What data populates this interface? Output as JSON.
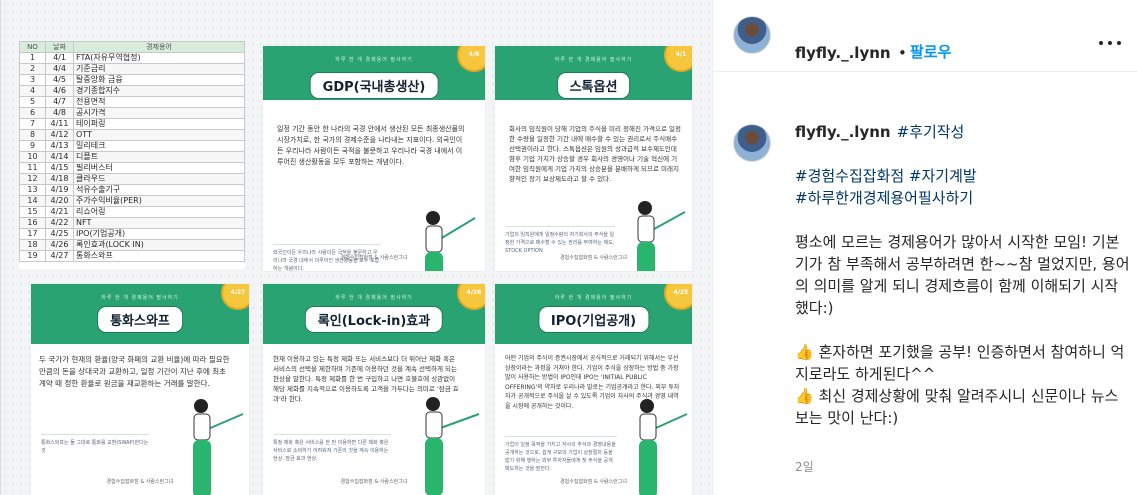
{
  "sheet": {
    "headers": [
      "NO",
      "날짜",
      "경제용어"
    ],
    "rows": [
      [
        "1",
        "4/1",
        "FTA(자유무역협정)"
      ],
      [
        "2",
        "4/4",
        "기준금리"
      ],
      [
        "3",
        "4/5",
        "탈중앙화 금융"
      ],
      [
        "4",
        "4/6",
        "경기종합지수"
      ],
      [
        "5",
        "4/7",
        "전용면적"
      ],
      [
        "6",
        "4/8",
        "공시가격"
      ],
      [
        "7",
        "4/11",
        "테이퍼링"
      ],
      [
        "8",
        "4/12",
        "OTT"
      ],
      [
        "9",
        "4/13",
        "밀리테크"
      ],
      [
        "10",
        "4/14",
        "디플트"
      ],
      [
        "11",
        "4/15",
        "필리버스터"
      ],
      [
        "12",
        "4/18",
        "클라우드"
      ],
      [
        "13",
        "4/19",
        "석유수출기구"
      ],
      [
        "14",
        "4/20",
        "주가수익비율(PER)"
      ],
      [
        "15",
        "4/21",
        "리쇼어링"
      ],
      [
        "16",
        "4/22",
        "NFT"
      ],
      [
        "17",
        "4/25",
        "IPO(기업공개)"
      ],
      [
        "18",
        "4/26",
        "록인효과(LOCK IN)"
      ],
      [
        "19",
        "4/27",
        "통화스와프"
      ]
    ]
  },
  "cards": [
    {
      "kicker": "하루 한 개 경제용어 필사하기",
      "title": "GDP(국내총생산)",
      "body": "일정 기간 동안 한 나라의 국경 안에서 생산된 모든 최종생산물의 시장가치로, 한 국가의 경제수준을 나타내는 지표이다. 외국인이든 우리나라 사람이든 국적을 불문하고 우리나라 국경 내에서 이루어진 생산활동을 모두 포함하는 개념이다.",
      "note": "외국인이든 우리나라 사람이든 국적을 불문하고 우리나라 국경 내에서 이루어진 생산활동을 모두 포함하는 개념이다.",
      "foot": "경험수집잡화점 & 사람스런그녀",
      "badge": "4/6"
    },
    {
      "kicker": "하루 한 개 경제용어 필사하기",
      "title": "스톡옵션",
      "body": "회사의 임직원이 당해 기업의 주식을 미리 정해진 가격으로 일정한 수량을 일정한 기간 내에 매수할 수 있는 권리로서 주식매수선택권이라고 한다. 스톡옵션은 임원의 성과급적 보수제도인데 향후 기업 가치가 상승할 경우 회사의 경영이나 기술 혁신에 기여한 임직원에게 기업 가치의 상승분을 분배하게 되므로 미래지향적인 장기 보상제도라고 할 수 있다.",
      "note": "기업의 임직원에게 일정수량의 자기회사의 주식을 일정한 가격으로 매수할 수 있는 권리를 부여하는 제도, STOCK OPTION",
      "foot": "경험수집잡화점 & 사람스런그녀",
      "badge": "4/1"
    },
    {
      "kicker": "하루 한 개 경제용어 필사하기",
      "title": "통화스와프",
      "body": "두 국가가 현재의 환율(양국 화폐의 교환 비율)에 따라 필요한 만큼의 돈을 상대국과 교환하고, 일정 기간이 지난 후에 최초 계약 때 정한 환율로 원금을 재교환하는 거래를 말한다.",
      "note": "통화스와프는 둘 그대로 통화를 교환(SWAP)한다는 것",
      "foot": "경험수집잡화점 & 사람스런그녀",
      "badge": "4/27"
    },
    {
      "kicker": "하루 한 개 경제용어 필사하기",
      "title": "록인(Lock-in)효과",
      "body": "현재 이용하고 있는 특정 제화 또는 서비스보다 더 뛰어난 제화 혹은 서비스의 선택을 제한하며 기존에 이용하던 것을 계속 선택하게 되는 현상을 말한다. 특정 제화를 한 번 구입하고 나면 호불호에 상관없이 해당 제화를 지속적으로 이용하도록 고객을 가두다는 의미로 '잠금 효과'라 한다.",
      "note": "특정 제화 혹은 서비스를 한 번 이용하면 다른 제화 혹은 서비스로 소비하기 어려워져 기존의 것을 계속 이용하는 현상. 잠금 효과 현상.",
      "foot": "경험수집잡화점 & 사람스런그녀",
      "badge": "4/26"
    },
    {
      "kicker": "하루 한 개 경제용어 필사하기",
      "title": "IPO(기업공개)",
      "body": "어떤 기업의 주식이 증권시장에서 공식적으로 거래되기 위해서는 우선 상장이라는 과정을 거쳐야 한다. 기업이 주식을 상장하는 방법 중 가장 많이 사용하는 방법이 IPO인데 IPO는 'INITIAL PUBLIC OFFERING'의 약자로 우리나라 말로는 기업공개라고 한다. 외부 투자자가 공개적으로 주식을 살 수 있도록 기업이 자사의 주식과 경영 내역을 시장에 공개하는 것이다.",
      "note": "기업이 일정 목적을 가지고 자사의 주식과 경영내용을 공개하는 것으로, 쉽게 구모의 기업이 상장절차 등을 밟기 위해 행하는 외부 투자자들에게 첫 주식을 공개 매도하는 것을 말한다.",
      "foot": "경험수집잡화점 & 사람스런그녀",
      "badge": "4/25"
    }
  ],
  "header": {
    "username": "flyfly._.lynn",
    "separator": "•",
    "follow_label": "팔로우"
  },
  "caption": {
    "username": "flyfly._.lynn",
    "first_tag": "#후기작성",
    "tags_line1": "#경험수집잡화점 #자기계발",
    "tags_line2": "#하루한개경제용어필사하기",
    "paragraph": "평소에 모르는 경제용어가 많아서 시작한 모임! 기본기가 참 부족해서 공부하려면 한~~참 멀었지만, 용어의 의미를 알게 되니 경제흐름이 함께 이해되기 시작했다:)",
    "emoji": "👍",
    "bullet1": "혼자하면 포기했을 공부! 인증하면서 참여하니 억지로라도 하게된다^^",
    "bullet2": "최신 경제상황에 맞춰 알려주시니 신문이나 뉴스보는 맛이 난다:)"
  },
  "timestamp": "2일",
  "colors": {
    "accent_green": "#2aa372",
    "link_blue": "#0095f6",
    "hashtag": "#00376b",
    "badge_gold": "#f6c63d"
  },
  "icons": [
    "more-options-icon",
    "avatar",
    "teacher-figure-illustration"
  ]
}
